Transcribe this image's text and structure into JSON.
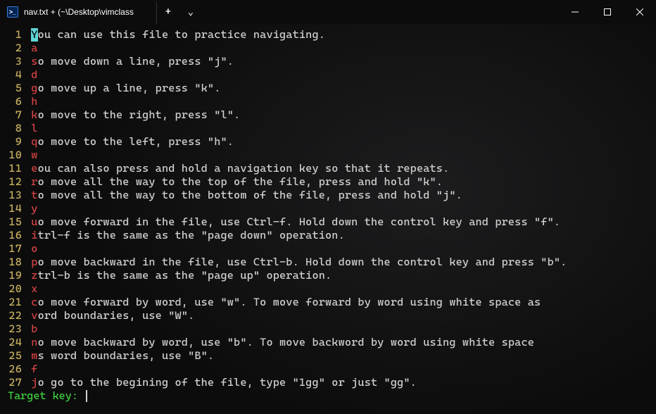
{
  "window": {
    "tab_title": "nav.txt + (~\\Desktop\\vimclass",
    "new_tab_symbol": "+",
    "dropdown_symbol": "⌄"
  },
  "lines": [
    {
      "n": "1",
      "first": "Y",
      "rest": "ou can use this file to practice navigating.",
      "cursor": true
    },
    {
      "n": "2",
      "first": "a",
      "rest": ""
    },
    {
      "n": "3",
      "first": "s",
      "rest": "o move down a line, press \"j\"."
    },
    {
      "n": "4",
      "first": "d",
      "rest": ""
    },
    {
      "n": "5",
      "first": "g",
      "rest": "o move up a line, press \"k\"."
    },
    {
      "n": "6",
      "first": "h",
      "rest": ""
    },
    {
      "n": "7",
      "first": "k",
      "rest": "o move to the right, press \"l\"."
    },
    {
      "n": "8",
      "first": "l",
      "rest": ""
    },
    {
      "n": "9",
      "first": "q",
      "rest": "o move to the left, press \"h\"."
    },
    {
      "n": "10",
      "first": "w",
      "rest": ""
    },
    {
      "n": "11",
      "first": "e",
      "rest": "ou can also press and hold a navigation key so that it repeats."
    },
    {
      "n": "12",
      "first": "r",
      "rest": "o move all the way to the top of the file, press and hold \"k\"."
    },
    {
      "n": "13",
      "first": "t",
      "rest": "o move all the way to the bottom of the file, press and hold \"j\"."
    },
    {
      "n": "14",
      "first": "y",
      "rest": ""
    },
    {
      "n": "15",
      "first": "u",
      "rest": "o move forward in the file, use Ctrl-f. Hold down the control key and press \"f\"."
    },
    {
      "n": "16",
      "first": "i",
      "rest": "trl-f is the same as the \"page down\" operation."
    },
    {
      "n": "17",
      "first": "o",
      "rest": ""
    },
    {
      "n": "18",
      "first": "p",
      "rest": "o move backward in the file, use Ctrl-b. Hold down the control key and press \"b\"."
    },
    {
      "n": "19",
      "first": "z",
      "rest": "trl-b is the same as the \"page up\" operation."
    },
    {
      "n": "20",
      "first": "x",
      "rest": ""
    },
    {
      "n": "21",
      "first": "c",
      "rest": "o move forward by word, use \"w\". To move forward by word using white space as"
    },
    {
      "n": "22",
      "first": "v",
      "rest": "ord boundaries, use \"W\"."
    },
    {
      "n": "23",
      "first": "b",
      "rest": ""
    },
    {
      "n": "24",
      "first": "n",
      "rest": "o move backward by word, use \"b\". To move backword by word using white space"
    },
    {
      "n": "25",
      "first": "m",
      "rest": "s word boundaries, use \"B\"."
    },
    {
      "n": "26",
      "first": "f",
      "rest": ""
    },
    {
      "n": "27",
      "first": "j",
      "rest": "o go to the begining of the file, type \"1gg\" or just \"gg\"."
    }
  ],
  "prompt": {
    "label": "Target key: "
  }
}
